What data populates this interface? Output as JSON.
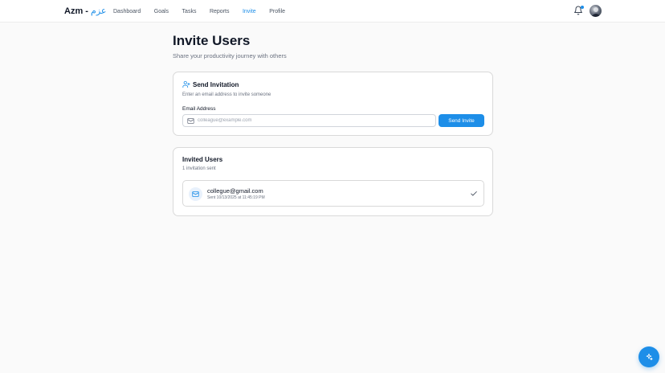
{
  "brand": {
    "name": "Azm -",
    "arabic": "عزم"
  },
  "nav": {
    "items": [
      {
        "label": "Dashboard",
        "active": false
      },
      {
        "label": "Goals",
        "active": false
      },
      {
        "label": "Tasks",
        "active": false
      },
      {
        "label": "Reports",
        "active": false
      },
      {
        "label": "Invite",
        "active": true
      },
      {
        "label": "Profile",
        "active": false
      }
    ]
  },
  "header_icons": {
    "notifications": "bell-icon",
    "has_unread": true,
    "avatar": "user-avatar"
  },
  "page": {
    "title": "Invite Users",
    "subtitle": "Share your productivity journey with others"
  },
  "send_card": {
    "title": "Send Invitation",
    "icon": "user-plus-icon",
    "description": "Enter an email address to invite someone",
    "email_label": "Email Address",
    "email_value": "",
    "email_placeholder": "colleague@example.com",
    "button_label": "Send Invite"
  },
  "invited_card": {
    "title": "Invited Users",
    "count_text": "1 invitation sent",
    "invites": [
      {
        "email": "collegue@gmail.com",
        "sent": "Sent 10/13/2025 at 11:45:19 PM",
        "status_icon": "check-icon"
      }
    ]
  },
  "fab": {
    "icon": "sparkle-icon"
  },
  "colors": {
    "accent": "#1d8ee8",
    "background": "#fafafa",
    "card_border": "#d9d9d9"
  }
}
